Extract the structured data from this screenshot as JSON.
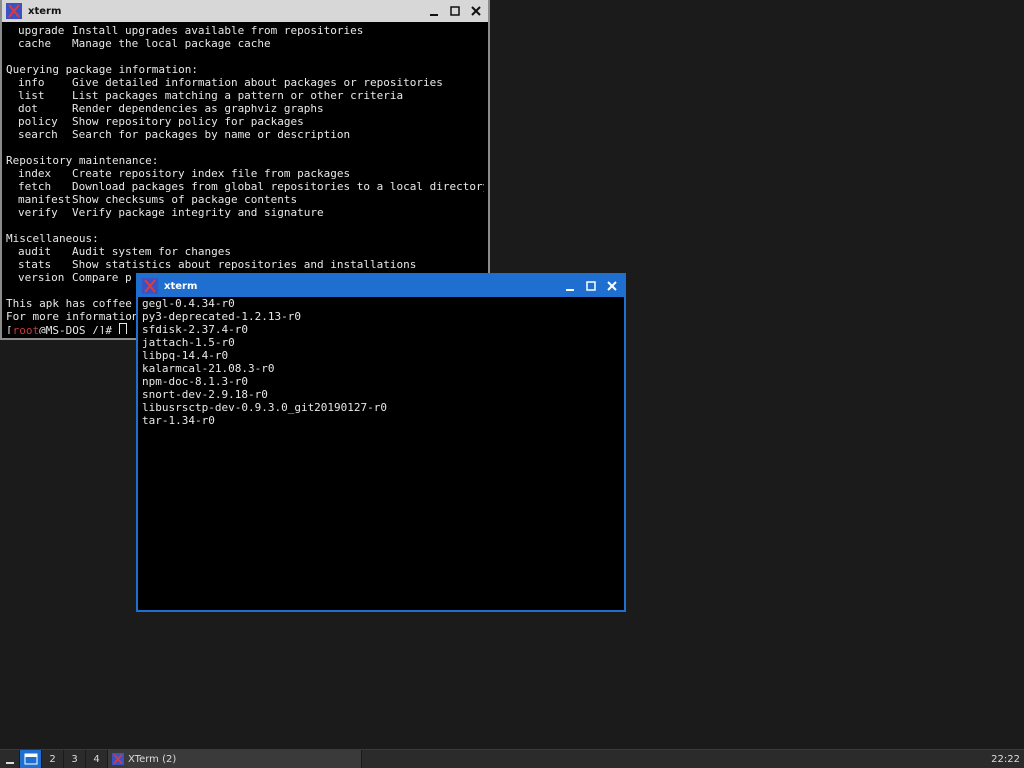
{
  "window1": {
    "title": "xterm",
    "lines": [
      {
        "cmd": "upgrade",
        "desc": "Install upgrades available from repositories"
      },
      {
        "cmd": "cache",
        "desc": "Manage the local package cache"
      },
      {
        "text": ""
      },
      {
        "text": "Querying package information:"
      },
      {
        "cmd": "info",
        "desc": "Give detailed information about packages or repositories"
      },
      {
        "cmd": "list",
        "desc": "List packages matching a pattern or other criteria"
      },
      {
        "cmd": "dot",
        "desc": "Render dependencies as graphviz graphs"
      },
      {
        "cmd": "policy",
        "desc": "Show repository policy for packages"
      },
      {
        "cmd": "search",
        "desc": "Search for packages by name or description"
      },
      {
        "text": ""
      },
      {
        "text": "Repository maintenance:"
      },
      {
        "cmd": "index",
        "desc": "Create repository index file from packages"
      },
      {
        "cmd": "fetch",
        "desc": "Download packages from global repositories to a local directory"
      },
      {
        "cmd": "manifest",
        "desc": "Show checksums of package contents"
      },
      {
        "cmd": "verify",
        "desc": "Verify package integrity and signature"
      },
      {
        "text": ""
      },
      {
        "text": "Miscellaneous:"
      },
      {
        "cmd": "audit",
        "desc": "Audit system for changes"
      },
      {
        "cmd": "stats",
        "desc": "Show statistics about repositories and installations"
      },
      {
        "cmd": "version",
        "desc": "Compare p"
      },
      {
        "text": ""
      },
      {
        "text": "This apk has coffee ma"
      },
      {
        "text": "For more information: "
      }
    ],
    "prompt": {
      "open": "[",
      "user": "root",
      "rest": "@MS-DOS /]# "
    }
  },
  "window2": {
    "title": "xterm",
    "lines": [
      "gegl-0.4.34-r0",
      "py3-deprecated-1.2.13-r0",
      "sfdisk-2.37.4-r0",
      "jattach-1.5-r0",
      "libpq-14.4-r0",
      "kalarmcal-21.08.3-r0",
      "npm-doc-8.1.3-r0",
      "snort-dev-2.9.18-r0",
      "libusrsctp-dev-0.9.3.0_git20190127-r0",
      "tar-1.34-r0"
    ]
  },
  "taskbar": {
    "workspaces": [
      "2",
      "3",
      "4"
    ],
    "task_label": "XTerm (2)",
    "clock": "22:22"
  },
  "icons": {
    "window_icon": "xterm-x-icon",
    "minimize": "minimize-icon",
    "maximize": "maximize-icon",
    "close": "close-icon"
  },
  "colors": {
    "active_title": "#1f6fd0",
    "inactive_title": "#d7d7d7",
    "desktop": "#1b1b1b",
    "prompt_user": "#c23a3a"
  }
}
